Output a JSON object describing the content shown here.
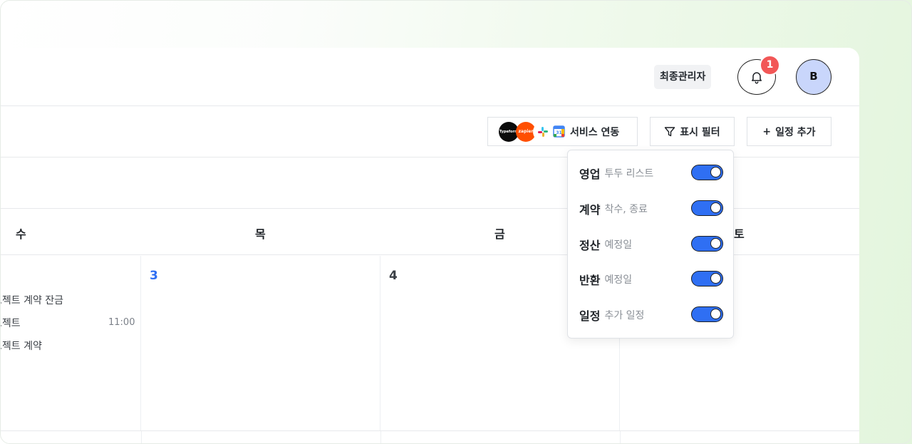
{
  "header": {
    "role_badge": "최종관리자",
    "notification_count": "1",
    "avatar_initial": "B"
  },
  "toolbar": {
    "service_logos": {
      "typeform": "Typeform",
      "zapier": "zapier"
    },
    "service_label": "서비스 연동",
    "filter_label": "표시 필터",
    "add_label": "일정 추가",
    "add_icon": "+"
  },
  "calendar": {
    "day_names": {
      "wed": "수",
      "thu": "목",
      "fri": "금",
      "sat": "토"
    },
    "dates": {
      "thu": "3",
      "fri": "4"
    },
    "events": [
      {
        "title": "로젝트 계약 잔금",
        "time": ""
      },
      {
        "title": "로젝트",
        "time": "11:00"
      },
      {
        "title": "로젝트 계약",
        "time": ""
      }
    ]
  },
  "filter_dropdown": {
    "items": [
      {
        "title": "영업",
        "subtitle": "투두 리스트",
        "enabled": true
      },
      {
        "title": "계약",
        "subtitle": "착수, 종료",
        "enabled": true
      },
      {
        "title": "정산",
        "subtitle": "예정일",
        "enabled": true
      },
      {
        "title": "반환",
        "subtitle": "예정일",
        "enabled": true
      },
      {
        "title": "일정",
        "subtitle": "추가 일정",
        "enabled": true
      }
    ]
  },
  "colors": {
    "accent": "#2f6ff3",
    "today_date": "#2f6ff3",
    "badge": "#f25757",
    "avatar_bg": "#c9d6fb"
  }
}
